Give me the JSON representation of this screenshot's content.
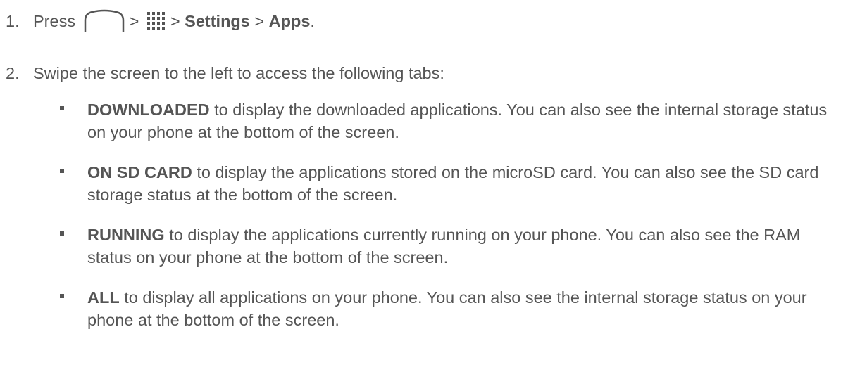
{
  "steps": [
    {
      "number": "1.",
      "press": "Press",
      "sep1": ">",
      "sep2": ">",
      "settings": "Settings",
      "sep3": ">",
      "apps": "Apps",
      "end": ".",
      "icons": [
        "home-icon",
        "apps-grid-icon"
      ]
    },
    {
      "number": "2.",
      "text": "Swipe the screen to the left to access the following tabs:"
    }
  ],
  "tabs": [
    {
      "name": "DOWNLOADED",
      "description": " to display the downloaded applications. You can also see the internal storage status on your phone at the bottom of the screen."
    },
    {
      "name": "ON SD CARD",
      "description": " to display the applications stored on the microSD card. You can also see the SD card storage status at the bottom of the screen."
    },
    {
      "name": "RUNNING",
      "description": " to display the applications currently running on your phone. You can also see the RAM status on your phone at the bottom of the screen."
    },
    {
      "name": "ALL",
      "description": " to display all applications on your phone. You can also see the internal storage status on your phone at the bottom of the screen."
    }
  ],
  "colors": {
    "text": "#555555",
    "icon": "#555555"
  }
}
